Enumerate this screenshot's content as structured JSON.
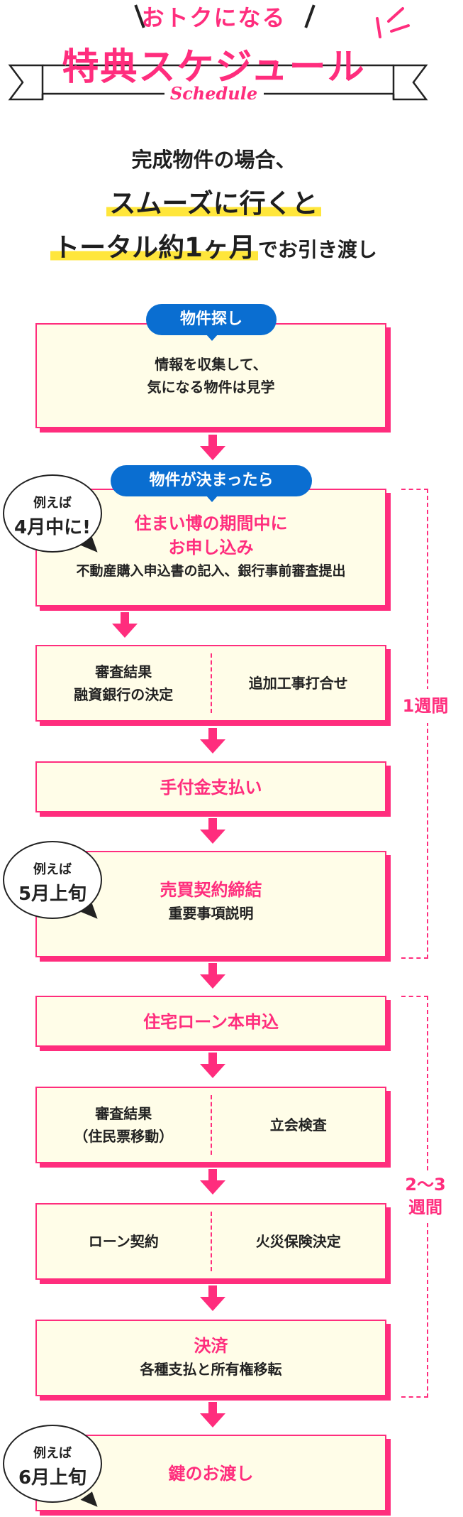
{
  "header": {
    "small_title": "おトクになる",
    "big_title": "特典スケジュール",
    "script_title": "Schedule"
  },
  "intro": {
    "line1": "完成物件の場合、",
    "line2": "スムーズに行くと",
    "line3_main": "トータル約1ヶ月",
    "line3_rest": "でお引き渡し"
  },
  "steps": {
    "search": {
      "pill": "物件探し",
      "line1": "情報を収集して、",
      "line2": "気になる物件は見学"
    },
    "decided": {
      "pill": "物件が決まったら",
      "title1": "住まい博の期間中に",
      "title2": "お申し込み",
      "sub": "不動産購入申込書の記入、銀行事前審査提出"
    },
    "review": {
      "left1": "審査結果",
      "left2": "融資銀行の決定",
      "right": "追加工事打合せ"
    },
    "deposit": {
      "title": "手付金支払い"
    },
    "contract": {
      "title": "売買契約締結",
      "sub": "重要事項説明"
    },
    "loan_apply": {
      "title": "住宅ローン本申込"
    },
    "review2": {
      "left1": "審査結果",
      "left2": "（住民票移動）",
      "right": "立会検査"
    },
    "loan_contract": {
      "left": "ローン契約",
      "right": "火災保険決定"
    },
    "settlement": {
      "title": "決済",
      "sub": "各種支払と所有権移転"
    },
    "handover": {
      "title": "鍵のお渡し"
    }
  },
  "bubbles": [
    {
      "line1": "例えば",
      "line2": "4月中に!"
    },
    {
      "line1": "例えば",
      "line2": "5月上旬"
    },
    {
      "line1": "例えば",
      "line2": "6月上旬"
    }
  ],
  "periods": {
    "first": "1週間",
    "second1": "2～3",
    "second2": "週間"
  },
  "colors": {
    "accent": "#ff2d7d",
    "pill": "#0a6ed1",
    "box_bg": "#fffde8",
    "highlight": "#ffe63b"
  }
}
